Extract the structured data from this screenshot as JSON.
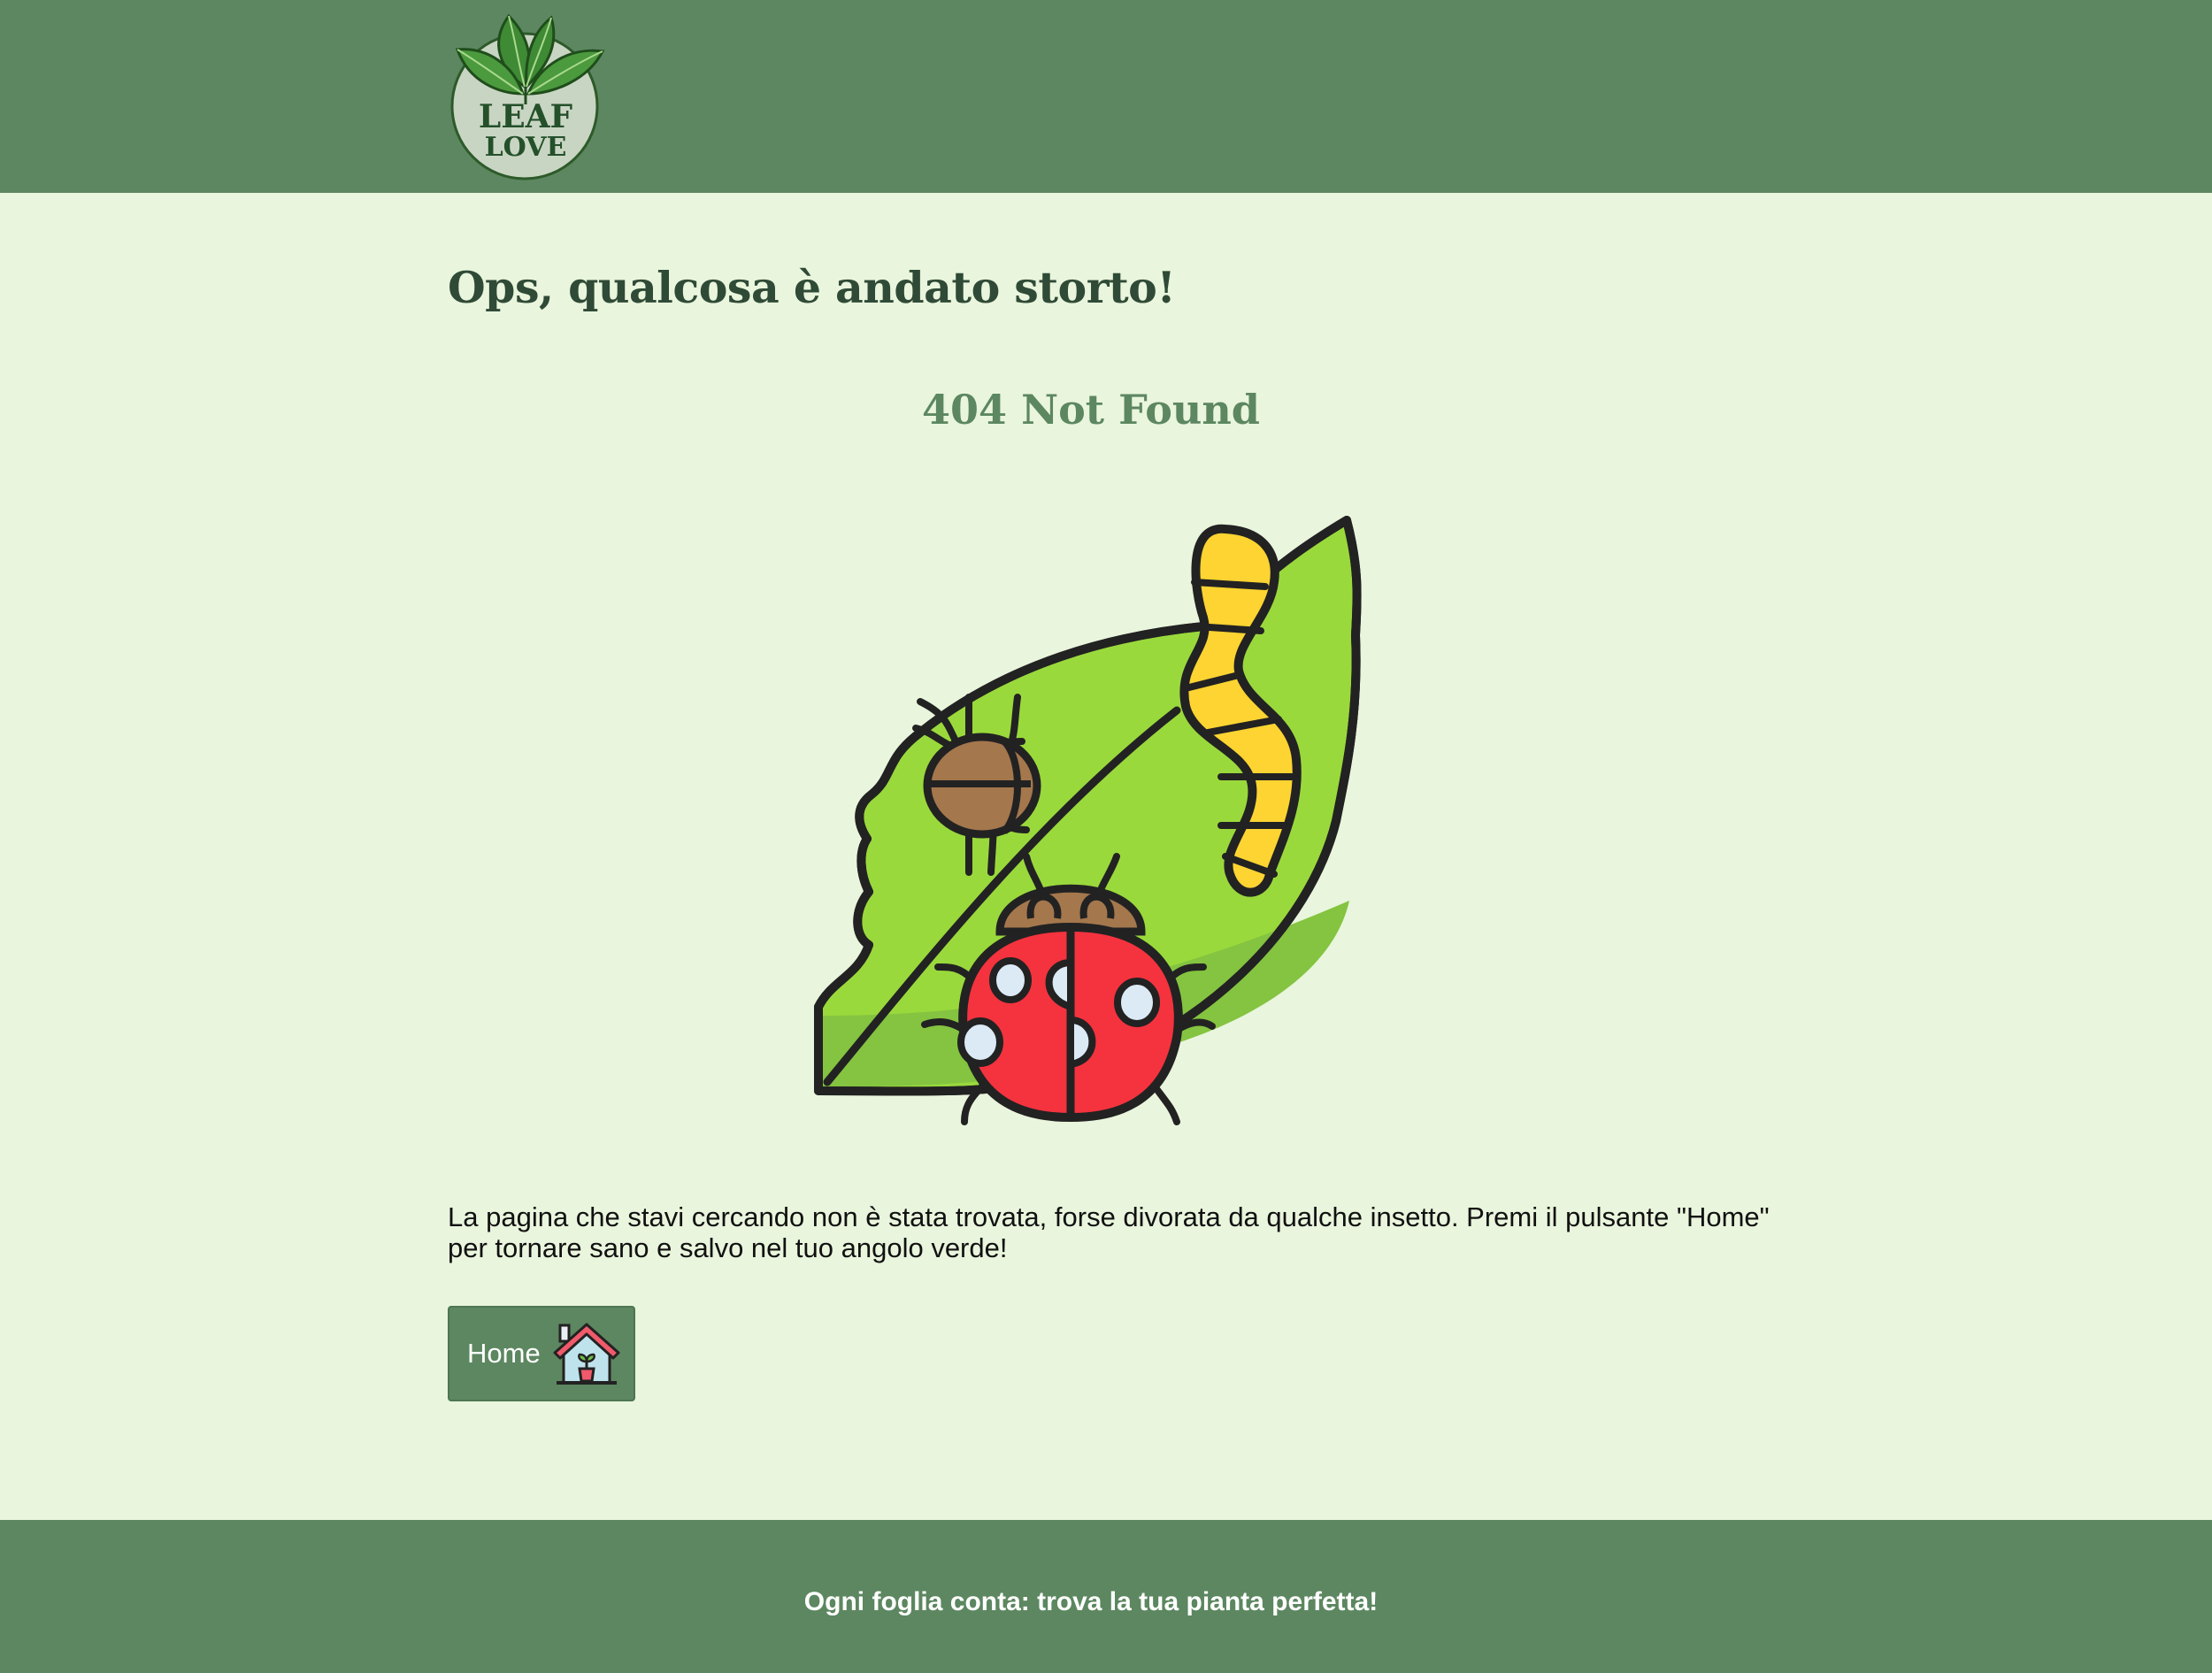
{
  "header": {
    "logo_line1": "LEAF",
    "logo_line2": "LOVE"
  },
  "main": {
    "heading": "Ops, qualcosa è andato storto!",
    "error_code": "404 Not Found",
    "illustration_icon": "bitten-leaf-with-insects-illustration",
    "message": "La pagina che stavi cercando non è stata trovata, forse divorata da qualche insetto. Premi il pulsante \"Home\" per tornare sano e salvo nel tuo angolo verde!",
    "home_button_label": "Home",
    "home_button_icon": "house-with-plant-icon"
  },
  "footer": {
    "tagline": "Ogni foglia conta: trova la tua pianta perfetta!"
  },
  "colors": {
    "brand_green": "#5c8760",
    "page_background": "#e9f5dc",
    "heading_color": "#2f4a36"
  }
}
